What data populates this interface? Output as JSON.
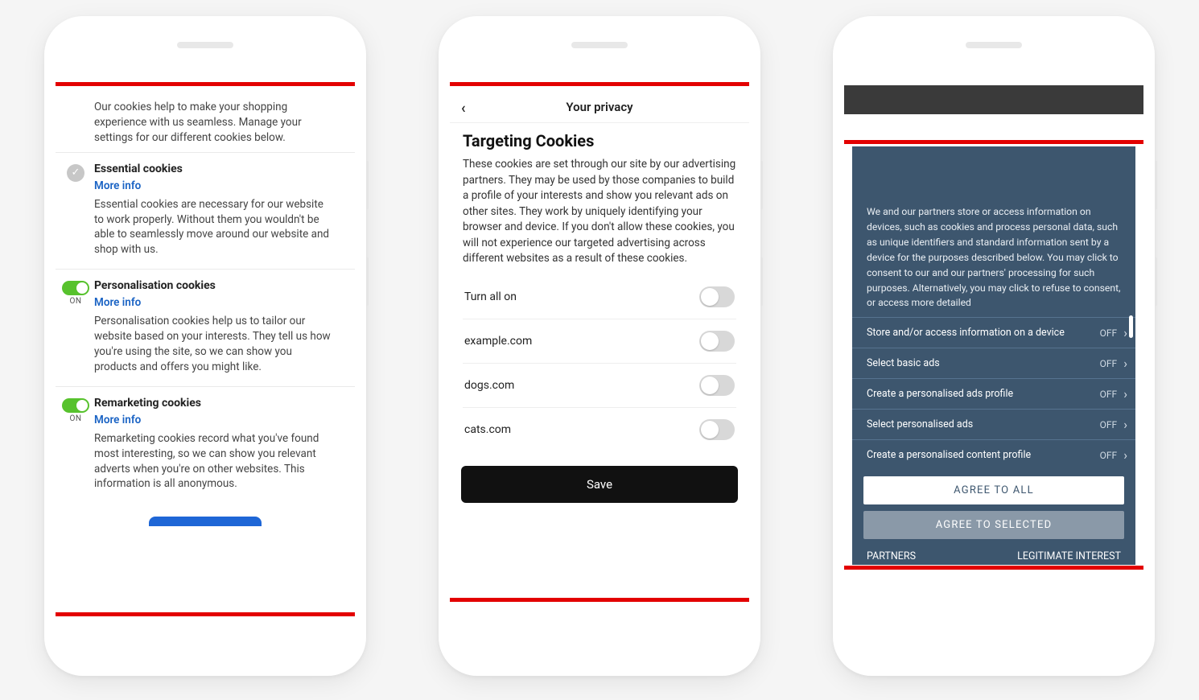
{
  "phone1": {
    "intro": "Our cookies help to make your shopping experience with us seamless. Manage your settings for our different cookies below.",
    "more_info_label": "More info",
    "on_label": "ON",
    "sections": [
      {
        "title": "Essential cookies",
        "desc": "Essential cookies are necessary for our website to work properly. Without them you wouldn't be able to seamlessly move around our website and shop with us."
      },
      {
        "title": "Personalisation cookies",
        "desc": "Personalisation cookies help us to tailor our website based on your interests. They tell us how you're using the site, so we can show you products and offers you might like."
      },
      {
        "title": "Remarketing cookies",
        "desc": "Remarketing cookies record what you've found most interesting, so we can show you relevant adverts when you're on other websites. This information is all anonymous."
      }
    ]
  },
  "phone2": {
    "header": "Your privacy",
    "title": "Targeting Cookies",
    "desc": "These cookies are set through our site by our advertising partners. They may be used by those companies to build a profile of your interests and show you relevant ads on other sites. They work by uniquely identifying your browser and device. If you don't allow these cookies, you will not experience our targeted advertising across different websites as a result of these cookies.",
    "turn_all": "Turn all on",
    "rows": [
      "example.com",
      "dogs.com",
      "cats.com"
    ],
    "save": "Save"
  },
  "phone3": {
    "intro": "We and our partners store or access information on devices, such as cookies and process personal data, such as unique identifiers and standard information sent by a device for the purposes described below. You may click to consent to our and our partners' processing for such purposes. Alternatively, you may click to refuse to consent, or access more detailed",
    "off_label": "OFF",
    "rows": [
      "Store and/or access information on a device",
      "Select basic ads",
      "Create a personalised ads profile",
      "Select personalised ads",
      "Create a personalised content profile"
    ],
    "agree_all": "AGREE TO ALL",
    "agree_selected": "AGREE TO SELECTED",
    "partners": "PARTNERS",
    "legit": "LEGITIMATE INTEREST"
  }
}
